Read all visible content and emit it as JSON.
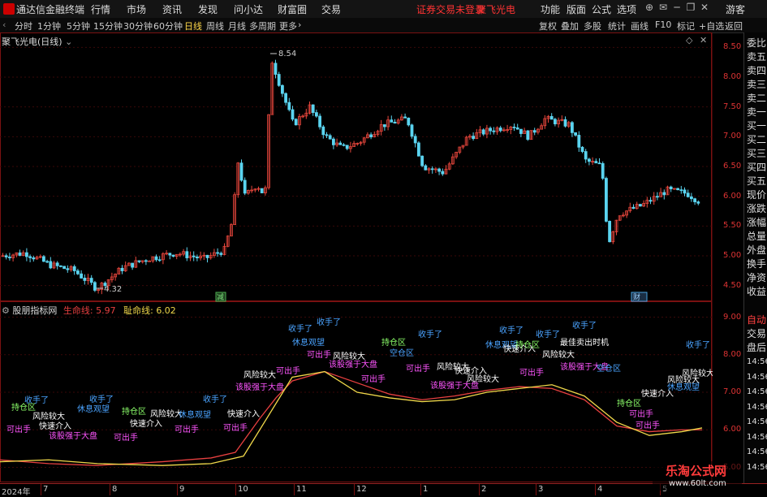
{
  "titlebar": {
    "app_name": "通达信金融终端",
    "menus": [
      "行情",
      "市场",
      "资讯",
      "发现",
      "问小达",
      "财富圈",
      "交易"
    ],
    "warning": "证券交易未登录",
    "stock_name": "聚飞光电",
    "right_menus": [
      "功能",
      "版面",
      "公式",
      "选项"
    ],
    "user": "游客"
  },
  "toolbar": {
    "periods": [
      "分时",
      "1分钟",
      "5分钟",
      "15分钟",
      "30分钟",
      "60分钟",
      "日线",
      "周线",
      "月线",
      "多周期",
      "更多"
    ],
    "active_period": "日线",
    "right_buttons": [
      "复权",
      "叠加",
      "多股",
      "统计",
      "画线",
      "F10",
      "标记",
      "+自选",
      "返回"
    ]
  },
  "main_chart": {
    "title": "聚飞光电(日线)",
    "high_label": "8.54",
    "low_label": "4.32",
    "yaxis": [
      "8.50",
      "8.00",
      "7.50",
      "7.00",
      "6.50",
      "6.00",
      "5.50",
      "5.00",
      "4.50"
    ],
    "event_left": "减",
    "event_right": "财",
    "colors": {
      "up": "#e8463c",
      "down": "#5ad4f0",
      "bg": "#000000",
      "grid": "#4a0b0b"
    }
  },
  "indicator": {
    "name": "股朋指标网",
    "life_label": "生命线:",
    "life_value": "5.97",
    "death_label": "耻命线:",
    "death_value": "6.02",
    "yaxis": [
      "9.00",
      "8.00",
      "7.00",
      "6.00",
      "5.00"
    ],
    "texts": [
      "持仓区",
      "风险较大",
      "快速介入",
      "可出手",
      "休息观望",
      "该股强于大盘",
      "收手了",
      "最佳卖出时机",
      "空仓区"
    ]
  },
  "sidebar": {
    "items": [
      "委比",
      "卖五",
      "卖四",
      "卖三",
      "卖二",
      "卖一",
      "买一",
      "买二",
      "买三",
      "买四",
      "买五",
      "现价",
      "涨跌",
      "涨幅",
      "总量",
      "外盘",
      "换手",
      "净资",
      "收益",
      "自动",
      "交易",
      "盘后",
      "14:56",
      "14:56",
      "14:56",
      "14:56",
      "14:56",
      "14:56",
      "14:56",
      "14:56"
    ]
  },
  "xaxis": [
    "2024年",
    "7",
    "8",
    "9",
    "10",
    "11",
    "12",
    "1",
    "2",
    "3",
    "4",
    "5"
  ],
  "watermark": {
    "name": "乐淘公式网",
    "url": "www.60lt.com"
  }
}
